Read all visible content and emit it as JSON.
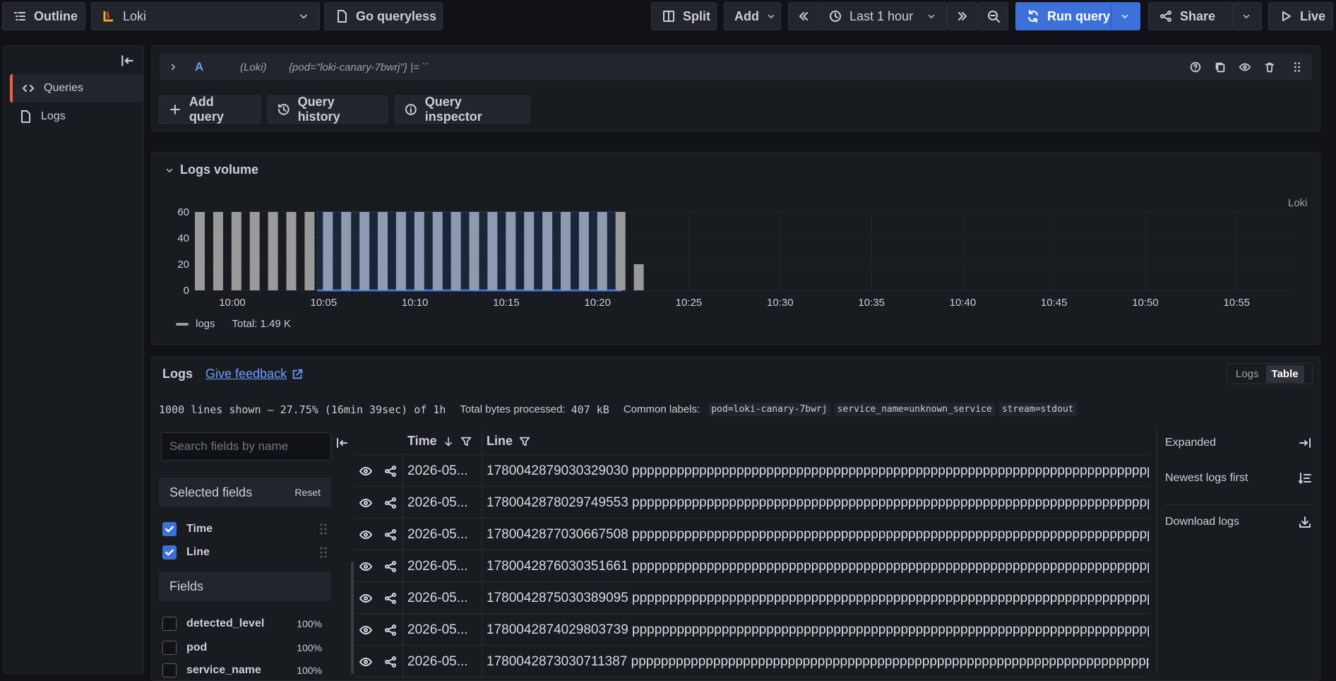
{
  "topbar": {
    "outline": "Outline",
    "datasource": "Loki",
    "queryless": "Go queryless",
    "split": "Split",
    "add": "Add",
    "time_range": "Last 1 hour",
    "run_query": "Run query",
    "share": "Share",
    "live": "Live"
  },
  "sidebar": {
    "items": [
      {
        "label": "Queries",
        "icon": "code-icon",
        "active": true
      },
      {
        "label": "Logs",
        "icon": "logs-icon",
        "active": false
      }
    ]
  },
  "query": {
    "ref_id": "A",
    "datasource": "(Loki)",
    "expr": "{pod=\"loki-canary-7bwrj\"} |= ``",
    "add_query": "Add query",
    "query_history": "Query history",
    "query_inspector": "Query inspector"
  },
  "volume": {
    "title": "Logs volume",
    "datasource_label": "Loki",
    "legend_label": "logs",
    "total": "Total: 1.49 K"
  },
  "chart_data": {
    "type": "bar",
    "ylim": [
      0,
      60
    ],
    "yticks": [
      "0",
      "20",
      "40",
      "60"
    ],
    "xticks": [
      "10:00",
      "10:05",
      "10:10",
      "10:15",
      "10:20",
      "10:25",
      "10:30",
      "10:35",
      "10:40",
      "10:45",
      "10:50",
      "10:55"
    ],
    "series": [
      {
        "values": [
          60,
          60,
          60,
          60,
          60,
          60,
          60,
          60,
          60,
          60,
          60,
          60,
          60,
          60,
          60,
          60,
          60,
          60,
          60,
          60,
          60,
          60,
          60,
          60,
          20
        ]
      }
    ],
    "grid": true,
    "legend": "bottom-left",
    "colors": {
      "bar": "#9a9a9a",
      "selected_bar": "#8e9ab1",
      "selection": "#3d71d9"
    }
  },
  "logs": {
    "title": "Logs",
    "feedback": "Give feedback",
    "view_logs": "Logs",
    "view_table": "Table",
    "summary": "1000 lines shown – 27.75% (16min 39sec) of 1h",
    "bytes_label": "Total bytes processed:",
    "bytes_value": "407 kB",
    "common_label": "Common labels:",
    "labels": [
      "pod=loki-canary-7bwrj",
      "service_name=unknown_service",
      "stream=stdout"
    ],
    "search_placeholder": "Search fields by name",
    "selected_fields_title": "Selected fields",
    "reset": "Reset",
    "selected_fields": [
      "Time",
      "Line"
    ],
    "fields_title": "Fields",
    "fields": [
      {
        "name": "detected_level",
        "pct": "100%"
      },
      {
        "name": "pod",
        "pct": "100%"
      },
      {
        "name": "service_name",
        "pct": "100%"
      }
    ],
    "col_time": "Time",
    "col_line": "Line",
    "rows": [
      {
        "time": "2026-05...",
        "line": "1780042879030329030 ppppppppppppppppppppppppppppppppppppppppppppppppppppppppppppppppppppppppppppppppppppp"
      },
      {
        "time": "2026-05...",
        "line": "1780042878029749553 ppppppppppppppppppppppppppppppppppppppppppppppppppppppppppppppppppppppppppppppppppppp"
      },
      {
        "time": "2026-05...",
        "line": "1780042877030667508 ppppppppppppppppppppppppppppppppppppppppppppppppppppppppppppppppppppppppppppppppppppp"
      },
      {
        "time": "2026-05...",
        "line": "1780042876030351661 ppppppppppppppppppppppppppppppppppppppppppppppppppppppppppppppppppppppppppppppppppppp"
      },
      {
        "time": "2026-05...",
        "line": "1780042875030389095 ppppppppppppppppppppppppppppppppppppppppppppppppppppppppppppppppppppppppppppppppppppp"
      },
      {
        "time": "2026-05...",
        "line": "1780042874029803739 ppppppppppppppppppppppppppppppppppppppppppppppppppppppppppppppppppppppppppppppppppppp"
      },
      {
        "time": "2026-05...",
        "line": "1780042873030711387 ppppppppppppppppppppppppppppppppppppppppppppppppppppppppppppppppppppppppppppppppppppp"
      }
    ],
    "options": {
      "expanded": "Expanded",
      "newest_first": "Newest logs first",
      "download": "Download logs"
    }
  }
}
